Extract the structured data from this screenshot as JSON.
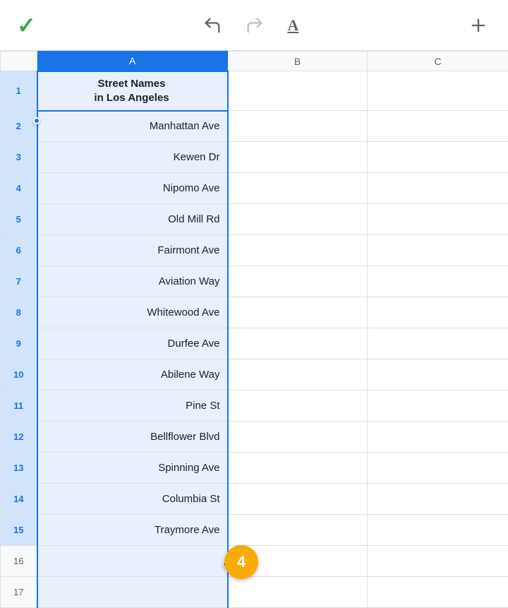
{
  "toolbar": {
    "check_label": "✓",
    "undo_label": "↩",
    "redo_label": "↪",
    "text_format_label": "A",
    "add_label": "+",
    "colors": {
      "check": "#34a853",
      "icons": "#5f6368",
      "redo_disabled": "#bdc1c6"
    }
  },
  "spreadsheet": {
    "columns": [
      {
        "id": "row_header",
        "label": ""
      },
      {
        "id": "A",
        "label": "A"
      },
      {
        "id": "B",
        "label": "B"
      },
      {
        "id": "C",
        "label": "C"
      }
    ],
    "rows": [
      {
        "num": "1",
        "a": "Street Names\nin Los Angeles",
        "b": "",
        "c": "",
        "is_header": true
      },
      {
        "num": "2",
        "a": "Manhattan Ave",
        "b": "",
        "c": ""
      },
      {
        "num": "3",
        "a": "Kewen Dr",
        "b": "",
        "c": ""
      },
      {
        "num": "4",
        "a": "Nipomo Ave",
        "b": "",
        "c": ""
      },
      {
        "num": "5",
        "a": "Old Mill Rd",
        "b": "",
        "c": ""
      },
      {
        "num": "6",
        "a": "Fairmont Ave",
        "b": "",
        "c": ""
      },
      {
        "num": "7",
        "a": "Aviation Way",
        "b": "",
        "c": ""
      },
      {
        "num": "8",
        "a": "Whitewood Ave",
        "b": "",
        "c": ""
      },
      {
        "num": "9",
        "a": "Durfee Ave",
        "b": "",
        "c": ""
      },
      {
        "num": "10",
        "a": "Abilene Way",
        "b": "",
        "c": ""
      },
      {
        "num": "11",
        "a": "Pine St",
        "b": "",
        "c": ""
      },
      {
        "num": "12",
        "a": "Bellflower Blvd",
        "b": "",
        "c": ""
      },
      {
        "num": "13",
        "a": "Spinning Ave",
        "b": "",
        "c": ""
      },
      {
        "num": "14",
        "a": "Columbia St",
        "b": "",
        "c": ""
      },
      {
        "num": "15",
        "a": "Traymore Ave",
        "b": "",
        "c": ""
      },
      {
        "num": "16",
        "a": "",
        "b": "",
        "c": ""
      },
      {
        "num": "17",
        "a": "",
        "b": "",
        "c": ""
      }
    ],
    "badge": {
      "value": "4",
      "color": "#f9ab00"
    }
  }
}
